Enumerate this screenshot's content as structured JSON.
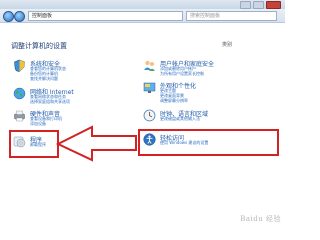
{
  "window": {
    "address": "控制面板",
    "search_placeholder": "搜索控制面板"
  },
  "content": {
    "heading": "调整计算机的设置",
    "view_by": "类别"
  },
  "categories": [
    {
      "key": "system",
      "title": "系统和安全",
      "links": [
        "查看您的计算机状态",
        "备份您的计算机",
        "查找并解决问题"
      ],
      "icon": "shield-icon"
    },
    {
      "key": "network",
      "title": "网络和 Internet",
      "links": [
        "查看网络状态和任务",
        "选择家庭组和共享选项"
      ],
      "icon": "globe-icon"
    },
    {
      "key": "hardware",
      "title": "硬件和声音",
      "links": [
        "查看设备和打印机",
        "添加设备"
      ],
      "icon": "printer-icon"
    },
    {
      "key": "programs",
      "title": "程序",
      "links": [
        "卸载程序"
      ],
      "icon": "cd-icon"
    },
    {
      "key": "users",
      "title": "用户帐户和家庭安全",
      "links": [
        "添加或删除用户帐户",
        "为所有用户设置家长控制"
      ],
      "icon": "users-icon"
    },
    {
      "key": "appearance",
      "title": "外观和个性化",
      "links": [
        "更改主题",
        "更改桌面背景",
        "调整屏幕分辨率"
      ],
      "icon": "appearance-icon"
    },
    {
      "key": "clock",
      "title": "时钟、语言和区域",
      "links": [
        "更改键盘或其他输入法"
      ],
      "icon": "clock-icon"
    },
    {
      "key": "access",
      "title": "轻松访问",
      "links": [
        "使用 Windows 建议的设置"
      ],
      "icon": "accessibility-icon"
    }
  ],
  "watermark": "Baidu 经验",
  "colors": {
    "highlight": "#d22222",
    "title_link": "#1e5aa8"
  }
}
